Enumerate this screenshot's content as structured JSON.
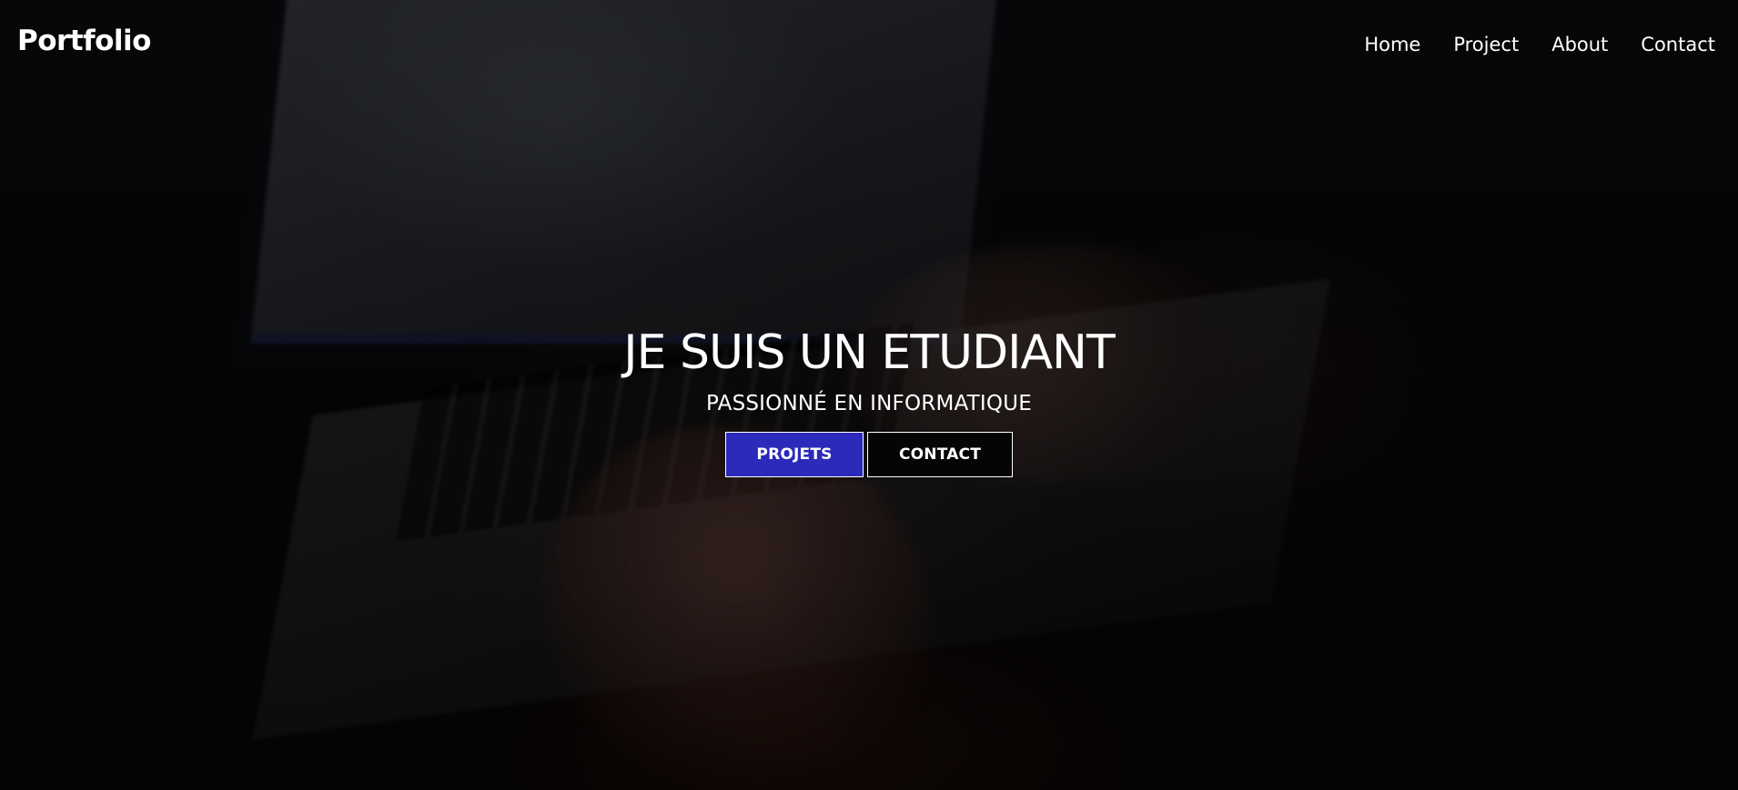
{
  "navbar": {
    "logo": "Portfolio",
    "links": [
      "Home",
      "Project",
      "About",
      "Contact"
    ]
  },
  "hero": {
    "title": "JE SUIS UN ETUDIANT",
    "subtitle": "PASSIONNÉ EN INFORMATIQUE",
    "buttons": {
      "primary_label": "PROJETS",
      "secondary_label": "CONTACT"
    }
  },
  "colors": {
    "primary_button": "#2b2aba",
    "secondary_button": "#050505",
    "text": "#ffffff"
  }
}
